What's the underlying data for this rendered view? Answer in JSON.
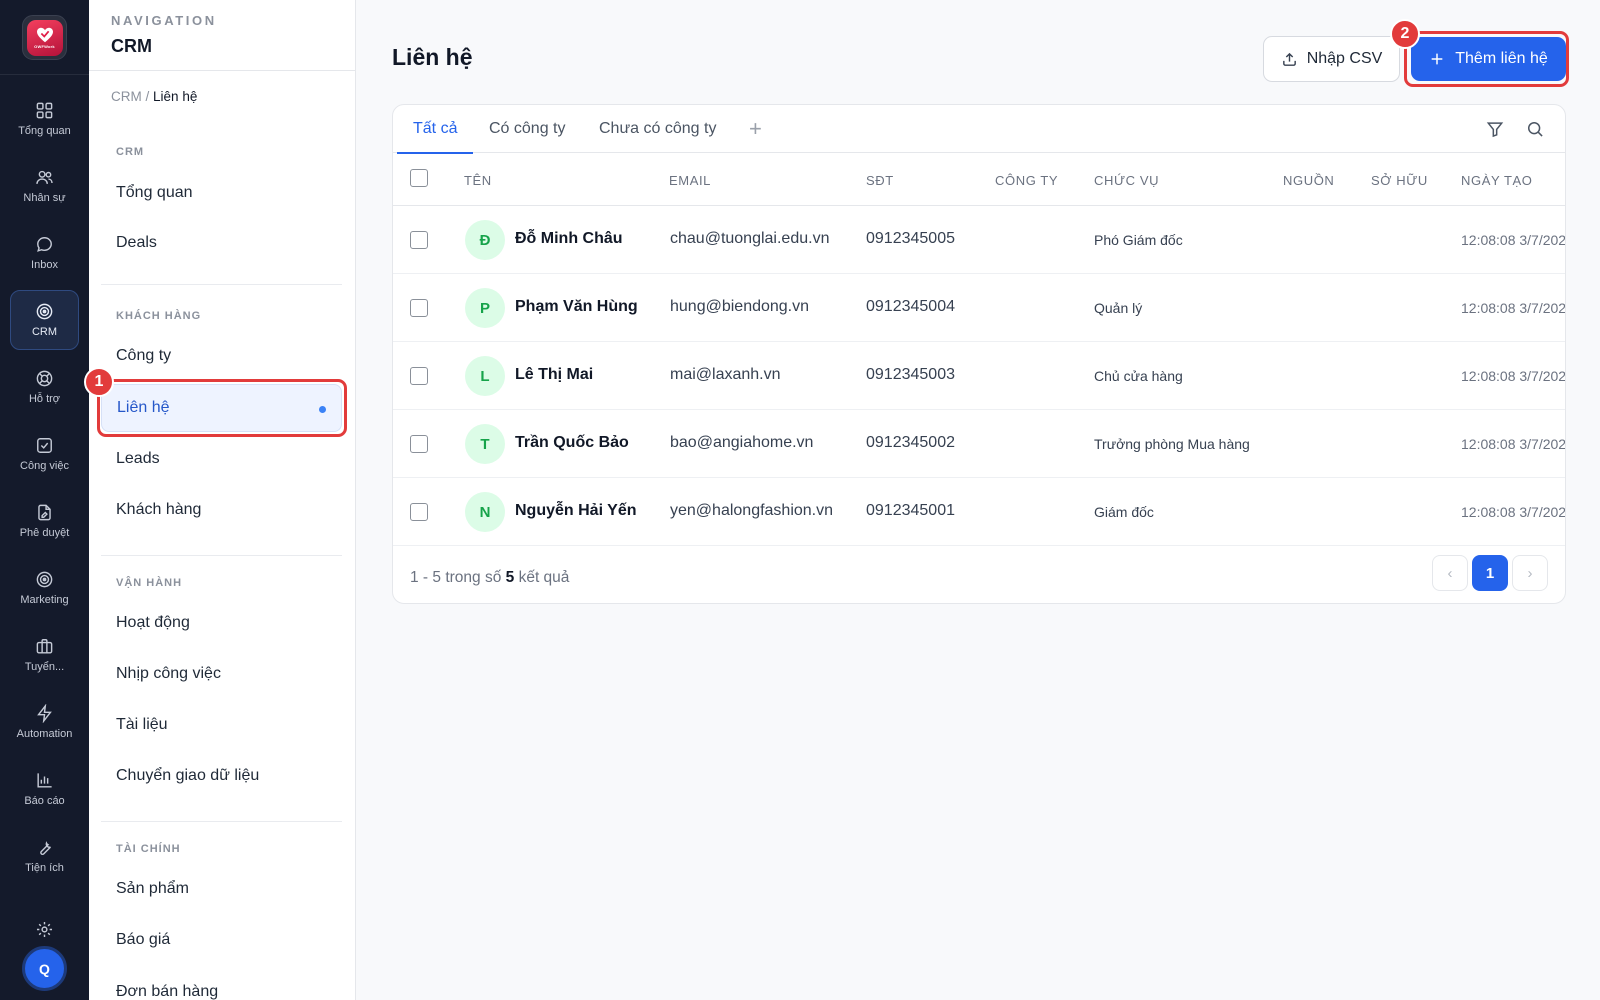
{
  "rail": {
    "logo_text": "OWFWork",
    "items": [
      {
        "label": "Tổng quan",
        "icon": "grid-icon"
      },
      {
        "label": "Nhân sự",
        "icon": "users-icon"
      },
      {
        "label": "Inbox",
        "icon": "chat-bubble-icon"
      },
      {
        "label": "CRM",
        "icon": "target-icon"
      },
      {
        "label": "Hỗ trợ",
        "icon": "lifebuoy-icon"
      },
      {
        "label": "Công việc",
        "icon": "checkbox-icon"
      },
      {
        "label": "Phê duyệt",
        "icon": "document-edit-icon"
      },
      {
        "label": "Marketing",
        "icon": "target-icon"
      },
      {
        "label": "Tuyển...",
        "icon": "briefcase-icon"
      },
      {
        "label": "Automation",
        "icon": "lightning-icon"
      },
      {
        "label": "Báo cáo",
        "icon": "bar-chart-icon"
      },
      {
        "label": "Tiện ích",
        "icon": "wrench-icon"
      }
    ],
    "avatar_initial": "Q"
  },
  "nav": {
    "kicker": "NAVIGATION",
    "title": "CRM",
    "breadcrumb_root": "CRM",
    "breadcrumb_sep": "/",
    "breadcrumb_current": "Liên hệ",
    "sections": {
      "crm": {
        "label": "CRM",
        "items": [
          "Tổng quan",
          "Deals"
        ]
      },
      "customers": {
        "label": "KHÁCH HÀNG",
        "items": [
          "Công ty",
          "Liên hệ",
          "Leads",
          "Khách hàng"
        ]
      },
      "operations": {
        "label": "VẬN HÀNH",
        "items": [
          "Hoạt động",
          "Nhịp công việc",
          "Tài liệu",
          "Chuyển giao dữ liệu"
        ]
      },
      "finance": {
        "label": "TÀI CHÍNH",
        "items": [
          "Sản phẩm",
          "Báo giá",
          "Đơn bán hàng"
        ]
      }
    }
  },
  "annotations": {
    "one": "1",
    "two": "2"
  },
  "main": {
    "title": "Liên hệ",
    "import_label": "Nhập CSV",
    "add_label": "Thêm liên hệ",
    "tabs": [
      "Tất cả",
      "Có công ty",
      "Chưa có công ty"
    ],
    "tab_add": "+",
    "columns": [
      "TÊN",
      "EMAIL",
      "SĐT",
      "CÔNG TY",
      "CHỨC VỤ",
      "NGUỒN",
      "SỞ HỮU",
      "NGÀY TẠO"
    ],
    "rows": [
      {
        "initial": "Đ",
        "name": "Đỗ Minh Châu",
        "email": "chau@tuonglai.edu.vn",
        "phone": "0912345005",
        "company": "",
        "role": "Phó Giám đốc",
        "source": "",
        "owner": "",
        "created": "12:08:08 3/7/202"
      },
      {
        "initial": "P",
        "name": "Phạm Văn Hùng",
        "email": "hung@biendong.vn",
        "phone": "0912345004",
        "company": "",
        "role": "Quản lý",
        "source": "",
        "owner": "",
        "created": "12:08:08 3/7/202"
      },
      {
        "initial": "L",
        "name": "Lê Thị Mai",
        "email": "mai@laxanh.vn",
        "phone": "0912345003",
        "company": "",
        "role": "Chủ cửa hàng",
        "source": "",
        "owner": "",
        "created": "12:08:08 3/7/202"
      },
      {
        "initial": "T",
        "name": "Trần Quốc Bảo",
        "email": "bao@angiahome.vn",
        "phone": "0912345002",
        "company": "",
        "role": "Trưởng phòng Mua hàng",
        "source": "",
        "owner": "",
        "created": "12:08:08 3/7/202"
      },
      {
        "initial": "N",
        "name": "Nguyễn Hải Yến",
        "email": "yen@halongfashion.vn",
        "phone": "0912345001",
        "company": "",
        "role": "Giám đốc",
        "source": "",
        "owner": "",
        "created": "12:08:08 3/7/202"
      }
    ],
    "footer": {
      "range": "1 - 5 trong số",
      "total": "5",
      "suffix": "kết quả"
    },
    "pagination": {
      "prev": "‹",
      "current": "1",
      "next": "›"
    }
  },
  "colors": {
    "accent": "#2563eb",
    "rail_bg": "#141a2b",
    "highlight": "#e23b3b",
    "avatar_bg": "#dcfce7",
    "avatar_fg": "#16a34a"
  }
}
